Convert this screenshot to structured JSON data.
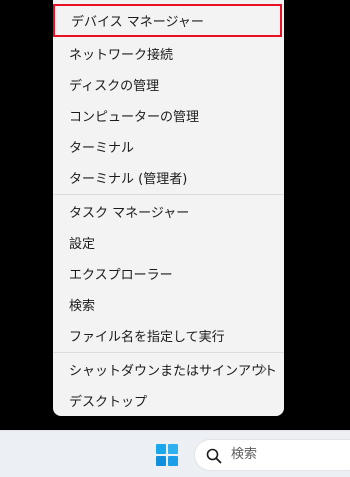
{
  "context_menu": {
    "items": [
      {
        "label": "デバイス マネージャー"
      },
      {
        "label": "ネットワーク接続"
      },
      {
        "label": "ディスクの管理"
      },
      {
        "label": "コンピューターの管理"
      },
      {
        "label": "ターミナル"
      },
      {
        "label": "ターミナル (管理者)"
      },
      {
        "label": "タスク マネージャー"
      },
      {
        "label": "設定"
      },
      {
        "label": "エクスプローラー"
      },
      {
        "label": "検索"
      },
      {
        "label": "ファイル名を指定して実行"
      },
      {
        "label": "シャットダウンまたはサインアウト",
        "submenu_icon": "chevron-right-icon"
      },
      {
        "label": "デスクトップ"
      }
    ],
    "highlight_color": "#e81123"
  },
  "taskbar": {
    "start_icon": "windows-logo-icon",
    "search": {
      "icon": "search-icon",
      "placeholder": "検索"
    }
  }
}
